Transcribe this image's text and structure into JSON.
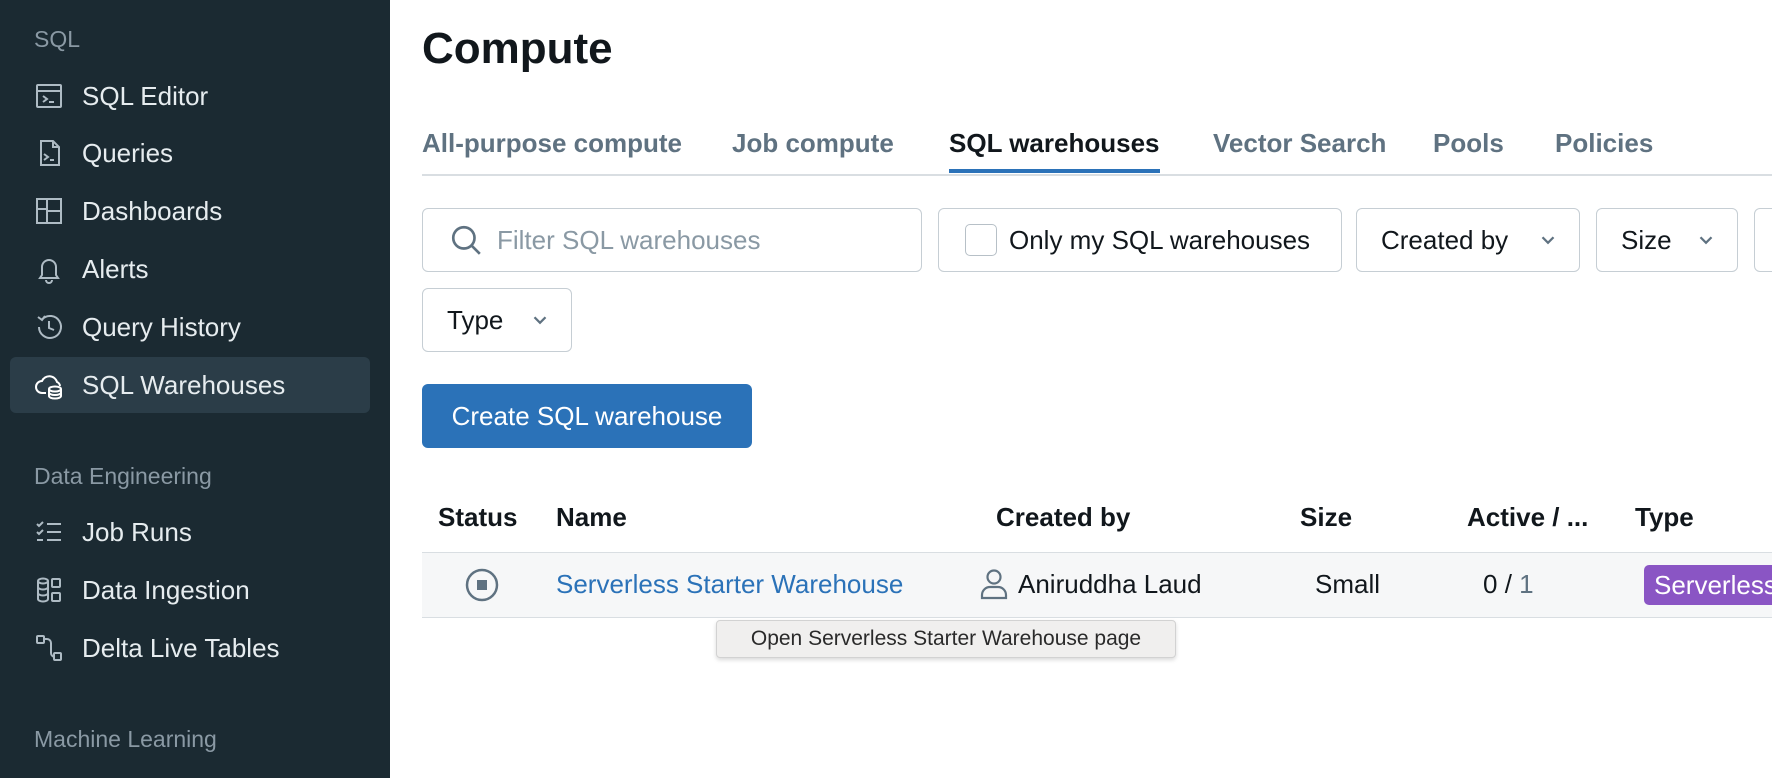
{
  "colors": {
    "sidebar_bg": "#1b2a32",
    "sidebar_active_bg": "#2b3d48",
    "accent": "#2b72b8",
    "serverless_badge": "#8a55c4"
  },
  "sidebar": {
    "sections": [
      {
        "label": "SQL",
        "items": [
          {
            "label": "SQL Editor",
            "icon": "sql-editor-icon"
          },
          {
            "label": "Queries",
            "icon": "queries-icon"
          },
          {
            "label": "Dashboards",
            "icon": "dashboards-icon"
          },
          {
            "label": "Alerts",
            "icon": "bell-icon"
          },
          {
            "label": "Query History",
            "icon": "history-icon"
          },
          {
            "label": "SQL Warehouses",
            "icon": "cloud-database-icon",
            "active": true
          }
        ]
      },
      {
        "label": "Data Engineering",
        "items": [
          {
            "label": "Job Runs",
            "icon": "checklist-icon"
          },
          {
            "label": "Data Ingestion",
            "icon": "data-ingestion-icon"
          },
          {
            "label": "Delta Live Tables",
            "icon": "pipeline-icon"
          }
        ]
      },
      {
        "label": "Machine Learning",
        "items": []
      }
    ]
  },
  "main": {
    "title": "Compute",
    "tabs": [
      {
        "label": "All-purpose compute"
      },
      {
        "label": "Job compute"
      },
      {
        "label": "SQL warehouses",
        "active": true
      },
      {
        "label": "Vector Search"
      },
      {
        "label": "Pools"
      },
      {
        "label": "Policies"
      }
    ],
    "filters": {
      "search_placeholder": "Filter SQL warehouses",
      "only_mine_label": "Only my SQL warehouses",
      "created_by_label": "Created by",
      "size_label": "Size",
      "type_label": "Type"
    },
    "create_button": "Create SQL warehouse",
    "table": {
      "columns": [
        "Status",
        "Name",
        "Created by",
        "Size",
        "Active / ...",
        "Type"
      ],
      "rows": [
        {
          "status": "stopped",
          "name": "Serverless Starter Warehouse",
          "created_by": "Aniruddha Laud",
          "size": "Small",
          "active": "0",
          "active_sep": " / ",
          "max": "1",
          "type": "Serverless"
        }
      ]
    },
    "tooltip": "Open Serverless Starter Warehouse page"
  }
}
